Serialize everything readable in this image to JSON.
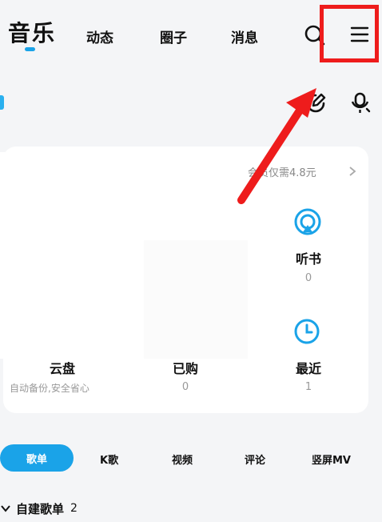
{
  "nav": {
    "tabs": [
      {
        "label": "音乐",
        "active": true
      },
      {
        "label": "动态"
      },
      {
        "label": "圈子"
      },
      {
        "label": "消息"
      }
    ]
  },
  "card": {
    "vip_banner": "会员仅需4.8元",
    "items": [
      {
        "title": "听书",
        "count": "0",
        "icon": "headphones-icon"
      },
      {
        "title": "最近",
        "count": "1",
        "icon": "clock-icon"
      },
      {
        "title": "云盘",
        "subtitle": "自动备份,安全省心",
        "icon": "cloud-icon"
      },
      {
        "title": "已购",
        "count": "0",
        "icon": "bag-icon"
      }
    ]
  },
  "subtabs": [
    {
      "label": "歌单",
      "active": true
    },
    {
      "label": "K歌"
    },
    {
      "label": "视频"
    },
    {
      "label": "评论"
    },
    {
      "label": "竖屏MV"
    }
  ],
  "playlist": {
    "label": "自建歌单",
    "count": "2"
  },
  "colors": {
    "accent": "#1aa3e8",
    "annotation": "#ee1c1c"
  }
}
